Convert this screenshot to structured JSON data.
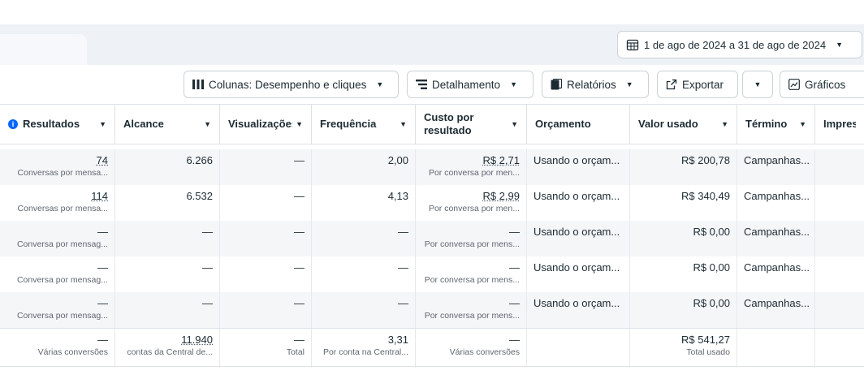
{
  "date_range": {
    "label": "1 de ago de 2024 a 31 de ago de 2024"
  },
  "toolbar": {
    "columns_label": "Colunas: Desempenho e cliques",
    "breakdown_label": "Detalhamento",
    "reports_label": "Relatórios",
    "export_label": "Exportar",
    "charts_label": "Gráficos"
  },
  "columns": {
    "results": "Resultados",
    "reach": "Alcance",
    "views": "Visualizações",
    "frequency": "Frequência",
    "cost_line1": "Custo por",
    "cost_line2": "resultado",
    "budget": "Orçamento",
    "amount_spent": "Valor usado",
    "end": "Término",
    "impressions": "Impress"
  },
  "rows": [
    {
      "results": "74",
      "results_sub": "Conversas por mensa...",
      "reach": "6.266",
      "views": "—",
      "frequency": "2,00",
      "cost": "R$ 2,71",
      "cost_sub": "Por conversa por men...",
      "budget": "Usando o orçam...",
      "spent": "R$ 200,78",
      "end": "Campanhas..."
    },
    {
      "results": "114",
      "results_sub": "Conversas por mensa...",
      "reach": "6.532",
      "views": "—",
      "frequency": "4,13",
      "cost": "R$ 2,99",
      "cost_sub": "Por conversa por men...",
      "budget": "Usando o orçam...",
      "spent": "R$ 340,49",
      "end": "Campanhas..."
    },
    {
      "results": "—",
      "results_sub": "Conversa por mensag...",
      "reach": "—",
      "views": "—",
      "frequency": "—",
      "cost": "—",
      "cost_sub": "Por conversa por mens...",
      "budget": "Usando o orçam...",
      "spent": "R$ 0,00",
      "end": "Campanhas..."
    },
    {
      "results": "—",
      "results_sub": "Conversa por mensag...",
      "reach": "—",
      "views": "—",
      "frequency": "—",
      "cost": "—",
      "cost_sub": "Por conversa por mens...",
      "budget": "Usando o orçam...",
      "spent": "R$ 0,00",
      "end": "Campanhas..."
    },
    {
      "results": "—",
      "results_sub": "Conversa por mensag...",
      "reach": "—",
      "views": "—",
      "frequency": "—",
      "cost": "—",
      "cost_sub": "Por conversa por mens...",
      "budget": "Usando o orçam...",
      "spent": "R$ 0,00",
      "end": "Campanhas..."
    }
  ],
  "totals": {
    "results": "—",
    "results_sub": "Várias conversões",
    "reach": "11.940",
    "reach_sub": "contas da Central de...",
    "views": "—",
    "views_sub": "Total",
    "frequency": "3,31",
    "frequency_sub": "Por conta na Central...",
    "cost": "—",
    "cost_sub": "Várias conversões",
    "spent": "R$ 541,27",
    "spent_sub": "Total usado"
  }
}
